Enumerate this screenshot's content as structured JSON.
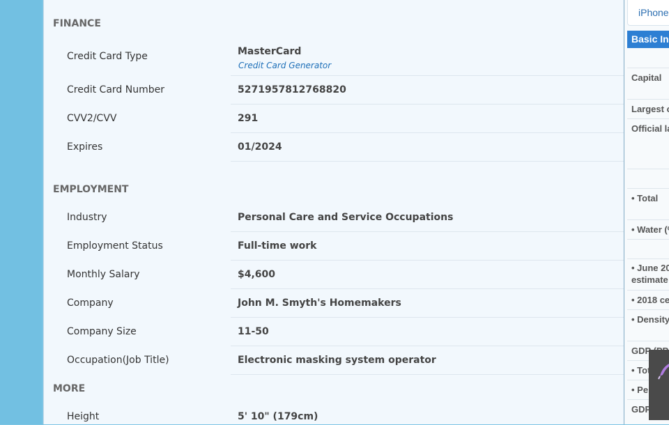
{
  "finance": {
    "heading": "FINANCE",
    "credit_card_type_label": "Credit Card Type",
    "credit_card_type_value": "MasterCard",
    "credit_card_generator_link": "Credit Card Generator",
    "credit_card_number_label": "Credit Card Number",
    "credit_card_number_value": "5271957812768820",
    "cvv_label": "CVV2/CVV",
    "cvv_value": "291",
    "expires_label": "Expires",
    "expires_value": "01/2024"
  },
  "employment": {
    "heading": "EMPLOYMENT",
    "rows": [
      {
        "label": "Industry",
        "value": "Personal Care and Service Occupations"
      },
      {
        "label": "Employment Status",
        "value": "Full-time work"
      },
      {
        "label": "Monthly Salary",
        "value": "$4,600"
      },
      {
        "label": "Company",
        "value": "John M. Smyth's Homemakers"
      },
      {
        "label": "Company Size",
        "value": "11-50"
      },
      {
        "label": "Occupation(Job Title)",
        "value": "Electronic masking system operator"
      }
    ]
  },
  "more": {
    "heading": "MORE",
    "height_label": "Height",
    "height_value": "5' 10\" (179cm)"
  },
  "sidebar": {
    "tab_label": "iPhone",
    "basic_info_header": "Basic Inf",
    "rows": [
      "Capital",
      "Largest c",
      "Official la",
      "• Total",
      "• Water (%",
      "• June 20",
      "estimate",
      "• 2018 ce",
      "• Density",
      "GDP (PPP",
      "• Tot",
      "• Per",
      "GDP"
    ]
  },
  "colors": {
    "accent": "#2d7fd3",
    "link": "#1d6fb8",
    "panel_bg": "#f2f8fd",
    "page_bg": "#7cc4e4"
  },
  "icons": [
    "feather-pen-icon"
  ]
}
